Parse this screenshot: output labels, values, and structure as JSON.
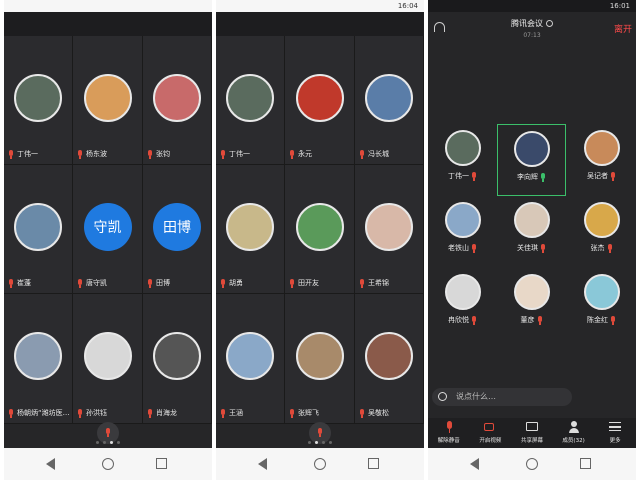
{
  "panel1": {
    "participants": [
      {
        "name": "丁伟一",
        "avatar_bg": "#5a6b5e"
      },
      {
        "name": "杨东波",
        "avatar_bg": "#d99c5a"
      },
      {
        "name": "张钧",
        "avatar_bg": "#c86a6a"
      },
      {
        "name": "崔蓬",
        "avatar_bg": "#6a8aa8"
      },
      {
        "name": "唐守凯",
        "avatar_text": "守凯"
      },
      {
        "name": "田博",
        "avatar_text": "田博"
      },
      {
        "name": "杨朝炳“潍坊医…",
        "avatar_bg": "#8a9bb0"
      },
      {
        "name": "孙洪钰",
        "avatar_bg": "#d8d8d8"
      },
      {
        "name": "肖海龙",
        "avatar_bg": "#555555"
      }
    ]
  },
  "panel2": {
    "status_time": "16:04",
    "participants": [
      {
        "name": "丁伟一",
        "avatar_bg": "#5a6b5e"
      },
      {
        "name": "永元",
        "avatar_bg": "#c0392b"
      },
      {
        "name": "冯长城",
        "avatar_bg": "#5a7da8"
      },
      {
        "name": "胡勇",
        "avatar_bg": "#c8b88a"
      },
      {
        "name": "田开友",
        "avatar_bg": "#5a9a5a"
      },
      {
        "name": "王希锦",
        "avatar_bg": "#d8b8a8"
      },
      {
        "name": "王涵",
        "avatar_bg": "#8aa8c8"
      },
      {
        "name": "张辉飞",
        "avatar_bg": "#a88a6a"
      },
      {
        "name": "吴敬松",
        "avatar_bg": "#8a5a4a"
      }
    ]
  },
  "panel3": {
    "status_time": "16:01",
    "battery": "80",
    "header": {
      "title": "腾讯会议",
      "subtitle": "07:13",
      "leave": "离开"
    },
    "participants": [
      {
        "name": "丁伟一",
        "avatar_bg": "#5a6b5e"
      },
      {
        "name": "李向辉",
        "avatar_bg": "#3a4a6a",
        "selected": true
      },
      {
        "name": "吴记者",
        "avatar_bg": "#c88a5a"
      },
      {
        "name": "老铁山",
        "avatar_bg": "#8aa8c8"
      },
      {
        "name": "关佳琪",
        "avatar_bg": "#d8c8b8"
      },
      {
        "name": "张杰",
        "avatar_bg": "#d8a84a"
      },
      {
        "name": "冉欣悦",
        "avatar_bg": "#d8d8d8"
      },
      {
        "name": "董彦",
        "avatar_bg": "#e8d8c8"
      },
      {
        "name": "陈金红",
        "avatar_bg": "#8ac8d8"
      }
    ],
    "chat_placeholder": "说点什么…",
    "toolbar": [
      {
        "label": "解除静音",
        "icon": "mic-icon"
      },
      {
        "label": "开启视频",
        "icon": "camera-icon"
      },
      {
        "label": "共享屏幕",
        "icon": "share-screen-icon"
      },
      {
        "label": "成员(32)",
        "icon": "members-icon"
      },
      {
        "label": "更多",
        "icon": "more-icon"
      }
    ]
  }
}
